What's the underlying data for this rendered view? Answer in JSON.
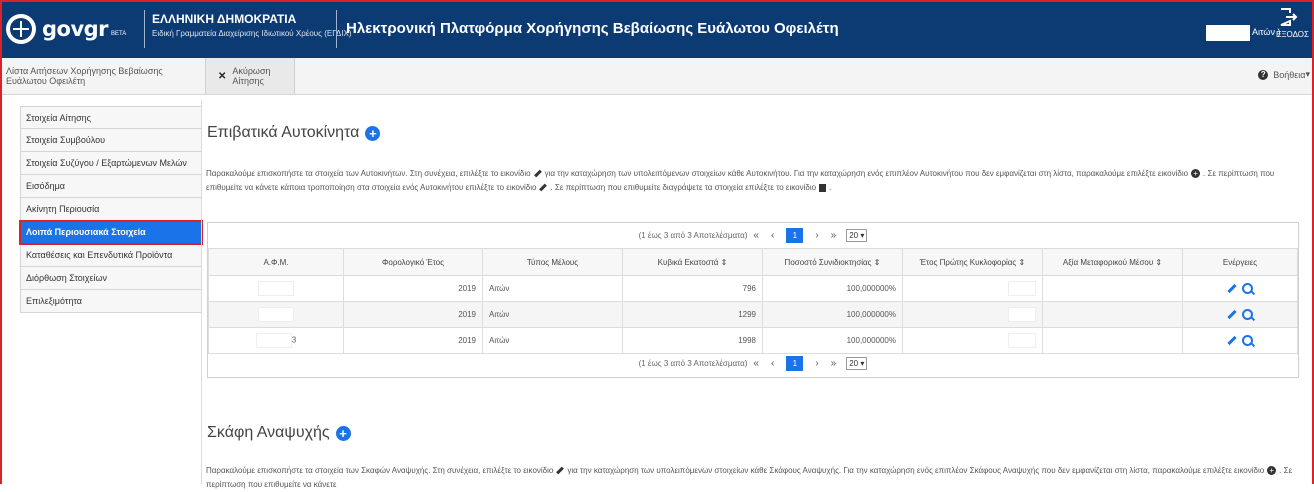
{
  "header": {
    "logo_text": "govgr",
    "logo_beta": "BETA",
    "republic": "ΕΛΛΗΝΙΚΗ ΔΗΜΟΚΡΑΤΙΑ",
    "secretariat": "Ειδική Γραμματεία Διαχείρισης Ιδιωτικού Χρέους (ΕΓΔΙΧ)",
    "platform_title": "Ηλεκτρονική Πλατφόρμα Χορήγησης Βεβαίωσης Ευάλωτου Οφειλέτη",
    "user_role": "Αιτών )",
    "exit_label": "ΕΞΟΔΟΣ"
  },
  "tabs": [
    {
      "label": "Λίστα Αιτήσεων Χορήγησης Βεβαίωσης Ευάλωτου Οφειλέτη"
    },
    {
      "label": "Ακύρωση Αίτησης"
    }
  ],
  "help_label": "Βοήθεια",
  "sidebar": {
    "items": [
      {
        "label": "Στοιχεία Αίτησης"
      },
      {
        "label": "Στοιχεία Συμβούλου"
      },
      {
        "label": "Στοιχεία Συζύγου / Εξαρτώμενων Μελών"
      },
      {
        "label": "Εισόδημα"
      },
      {
        "label": "Ακίνητη Περιουσία"
      },
      {
        "label": "Λοιπά Περιουσιακά Στοιχεία"
      },
      {
        "label": "Καταθέσεις και Επενδυτικά Προϊόντα"
      },
      {
        "label": "Διόρθωση Στοιχείων"
      },
      {
        "label": "Επιλεξιμότητα"
      }
    ]
  },
  "cars": {
    "title": "Επιβατικά Αυτοκίνητα",
    "desc1": "Παρακαλούμε επισκοπήστε τα στοιχεία των Αυτοκινήτων. Στη συνέχεια, επιλέξτε το εικονίδιο",
    "desc2": "για την καταχώρηση των υπολειπόμενων στοιχείων κάθε Αυτοκινήτου. Για την καταχώρηση ενός επιπλέον Αυτοκινήτου που δεν εμφανίζεται στη λίστα, παρακαλούμε επιλέξτε εικονίδιο",
    "desc3": ". Σε περίπτωση που επιθυμείτε να κάνετε κάποια τροποποίηση στα στοιχεία ενός Αυτοκινήτου επιλέξτε το εικονίδιο",
    "desc4": ". Σε περίπτωση που επιθυμείτε διαγράψετε τα στοιχεία επιλέξτε το εικονίδιο",
    "desc5": ".",
    "pager_text": "(1 έως 3 από 3 Αποτελέσματα)",
    "first": "«",
    "prev": "‹",
    "page": "1",
    "next": "›",
    "last": "»",
    "per_page": "20",
    "columns": [
      "Α.Φ.Μ.",
      "Φορολογικό Έτος",
      "Τύπος Μέλους",
      "Κυβικά Εκατοστά ⇕",
      "Ποσοστό Συνιδιοκτησίας ⇕",
      "Έτος Πρώτης Κυκλοφορίας ⇕",
      "Αξία Μεταφορικού Μέσου ⇕",
      "Ενέργειες"
    ],
    "rows": [
      {
        "afm": "",
        "year": "2019",
        "member": "Αιτών",
        "cc": "796",
        "share": "100,000000%"
      },
      {
        "afm": "",
        "year": "2019",
        "member": "Αιτών",
        "cc": "1299",
        "share": "100,000000%"
      },
      {
        "afm": "3",
        "year": "2019",
        "member": "Αιτών",
        "cc": "1998",
        "share": "100,000000%"
      }
    ]
  },
  "boats": {
    "title": "Σκάφη Αναψυχής",
    "desc1": "Παρακαλούμε επισκοπήστε τα στοιχεία των Σκαφών Αναψυχής. Στη συνέχεια, επιλέξτε το εικονίδιο",
    "desc2": "για την καταχώρηση των υπολειπόμενων στοιχείων κάθε Σκάφους Αναψυχής. Για την καταχώρηση ενός επιπλέον Σκάφους Αναψυχής που δεν εμφανίζεται στη λίστα, παρακαλούμε επιλέξτε εικονίδιο",
    "desc3": ". Σε περίπτωση που επιθυμείτε να κάνετε"
  },
  "colors": {
    "header_bg": "#0c3a73",
    "accent": "#1a73e8",
    "highlight_border": "#d9222a"
  },
  "icons": [
    "exit-icon",
    "close-icon",
    "help-icon",
    "add-icon",
    "edit-icon",
    "search-icon",
    "delete-icon"
  ]
}
